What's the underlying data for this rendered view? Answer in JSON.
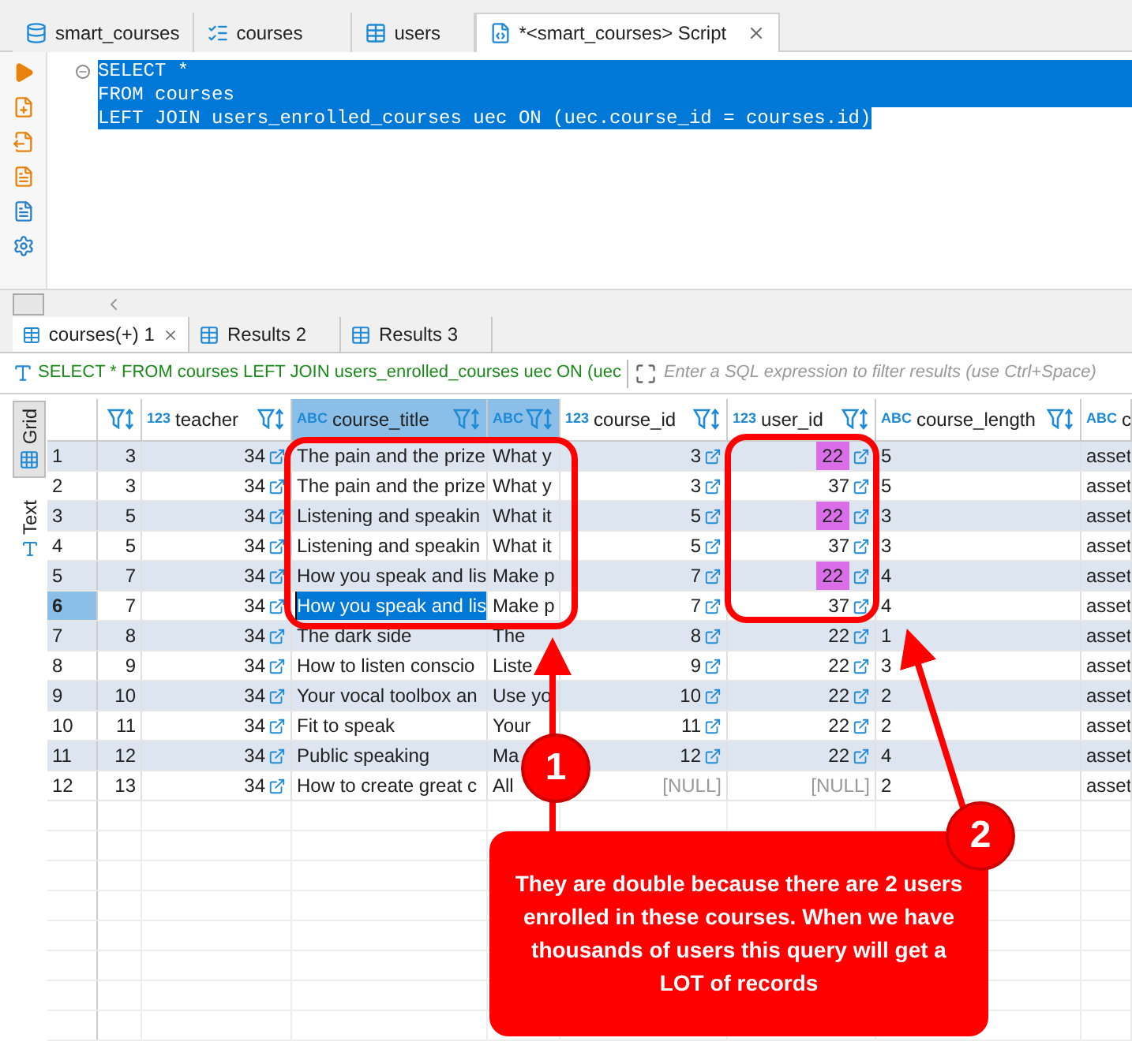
{
  "editor_tabs": [
    {
      "label": "smart_courses",
      "kind": "database",
      "selected": false,
      "closable": false
    },
    {
      "label": "courses",
      "kind": "table-check",
      "selected": false,
      "closable": false
    },
    {
      "label": "users",
      "kind": "table",
      "selected": false,
      "closable": false
    },
    {
      "label": "*<smart_courses> Script",
      "kind": "script",
      "selected": true,
      "closable": true
    }
  ],
  "editor": {
    "lines": [
      {
        "text": "SELECT *",
        "selected": true,
        "foldable": true
      },
      {
        "text": "FROM courses",
        "selected": true,
        "foldable": false
      },
      {
        "text": "LEFT JOIN users_enrolled_courses uec ON (uec.course_id = courses.id)",
        "selected": true,
        "foldable": false
      }
    ]
  },
  "results_tabs": [
    {
      "label": "courses(+) 1",
      "selected": true,
      "closable": true
    },
    {
      "label": "Results 2",
      "selected": false,
      "closable": false
    },
    {
      "label": "Results 3",
      "selected": false,
      "closable": false
    }
  ],
  "filter_bar": {
    "query": "SELECT * FROM courses LEFT JOIN users_enrolled_courses uec ON (uec",
    "placeholder": "Enter a SQL expression to filter results (use Ctrl+Space)"
  },
  "view_modes": [
    {
      "label": "Grid",
      "kind": "grid",
      "selected": true
    },
    {
      "label": "Text",
      "kind": "text",
      "selected": false
    }
  ],
  "table": {
    "columns": [
      {
        "kind": "plain",
        "selected": false
      },
      {
        "label": "teacher",
        "type_label": "123",
        "kind": "ref",
        "selected": false
      },
      {
        "label": "course_title",
        "type_label": "ABC",
        "kind": "text",
        "selected": true
      },
      {
        "type_label": "ABC",
        "kind": "text",
        "selected": true
      },
      {
        "label": "course_id",
        "type_label": "123",
        "kind": "ref",
        "selected": false
      },
      {
        "label": "user_id",
        "type_label": "123",
        "kind": "ref",
        "selected": false
      },
      {
        "label": "course_length",
        "type_label": "ABC",
        "kind": "text",
        "selected": false
      },
      {
        "label": "c",
        "type_label": "ABC",
        "kind": "text",
        "selected": false
      }
    ],
    "rows": [
      {
        "number": "1",
        "selected": false,
        "user_highlighted": true,
        "cells": [
          "3",
          "34",
          "The pain and the prize",
          "What y",
          "3",
          "22",
          "5",
          "asset"
        ]
      },
      {
        "number": "2",
        "selected": false,
        "user_highlighted": false,
        "cells": [
          "3",
          "34",
          "The pain and the prize",
          "What y",
          "3",
          "37",
          "5",
          "asset"
        ]
      },
      {
        "number": "3",
        "selected": false,
        "user_highlighted": true,
        "cells": [
          "5",
          "34",
          "Listening and speakin",
          "What it",
          "5",
          "22",
          "3",
          "asset"
        ]
      },
      {
        "number": "4",
        "selected": false,
        "user_highlighted": false,
        "cells": [
          "5",
          "34",
          "Listening and speakin",
          "What it",
          "5",
          "37",
          "3",
          "asset"
        ]
      },
      {
        "number": "5",
        "selected": false,
        "user_highlighted": true,
        "cells": [
          "7",
          "34",
          "How you speak and lis",
          "Make p",
          "7",
          "22",
          "4",
          "asset"
        ]
      },
      {
        "number": "6",
        "selected": true,
        "user_highlighted": false,
        "cells": [
          "7",
          "34",
          "How you speak and lis",
          "Make p",
          "7",
          "37",
          "4",
          "asset"
        ]
      },
      {
        "number": "7",
        "selected": false,
        "user_highlighted": false,
        "cells": [
          "8",
          "34",
          "The dark side",
          "The",
          "8",
          "22",
          "1",
          "asset"
        ]
      },
      {
        "number": "8",
        "selected": false,
        "user_highlighted": false,
        "cells": [
          "9",
          "34",
          "How to listen conscio",
          "Liste",
          "9",
          "22",
          "3",
          "asset"
        ]
      },
      {
        "number": "9",
        "selected": false,
        "user_highlighted": false,
        "cells": [
          "10",
          "34",
          "Your vocal toolbox an",
          "Use yo",
          "10",
          "22",
          "2",
          "asset"
        ]
      },
      {
        "number": "10",
        "selected": false,
        "user_highlighted": false,
        "cells": [
          "11",
          "34",
          "Fit to speak",
          "Your",
          "11",
          "22",
          "2",
          "asset"
        ]
      },
      {
        "number": "11",
        "selected": false,
        "user_highlighted": false,
        "cells": [
          "12",
          "34",
          "Public speaking",
          "Ma",
          "12",
          "22",
          "4",
          "asset"
        ]
      },
      {
        "number": "12",
        "selected": false,
        "user_highlighted": false,
        "cells": [
          "13",
          "34",
          "How to create great c",
          "All",
          {
            "text": "[NULL]",
            "null": true
          },
          {
            "text": "[NULL]",
            "null": true
          },
          "2",
          "asset"
        ]
      }
    ]
  },
  "annotations": {
    "markers": [
      "1",
      "2"
    ],
    "note": "They are double because there are 2 users enrolled in these courses. When we have thousands of users this query will get a LOT of records"
  }
}
